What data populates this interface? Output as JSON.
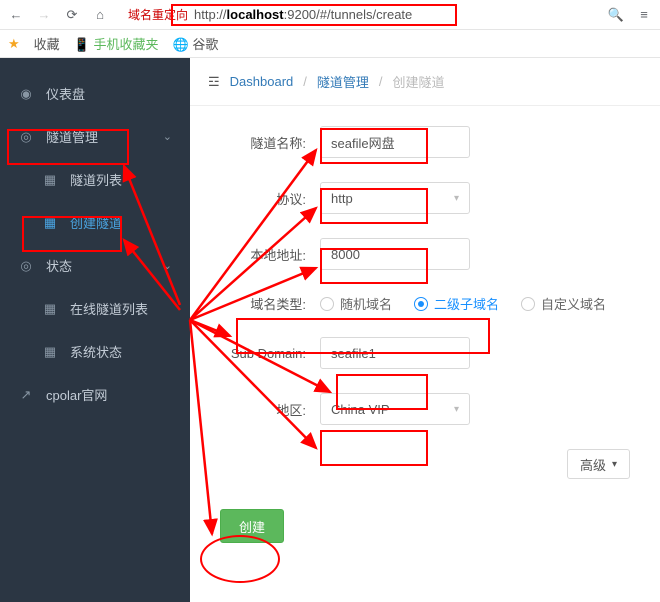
{
  "browser": {
    "redirect_label": "域名重定向",
    "url_prefix": "http://",
    "url_host": "localhost",
    "url_rest": ":9200/#/tunnels/create",
    "fav_label": "收藏",
    "mobile_label": "手机收藏夹",
    "google_label": "谷歌"
  },
  "sidebar": {
    "dashboard": "仪表盘",
    "tunnel_mgmt": "隧道管理",
    "tunnel_list": "隧道列表",
    "create_tunnel": "创建隧道",
    "status": "状态",
    "online_list": "在线隧道列表",
    "sys_status": "系统状态",
    "cpolar_site": "cpolar官网"
  },
  "crumb": {
    "dashboard": "Dashboard",
    "tunnel_mgmt": "隧道管理",
    "create_tunnel": "创建隧道"
  },
  "labels": {
    "name": "隧道名称:",
    "protocol": "协议:",
    "local_addr": "本地地址:",
    "domain_type": "域名类型:",
    "sub_domain": "Sub Domain:",
    "region": "地区:"
  },
  "values": {
    "name": "seafile网盘",
    "protocol": "http",
    "local_addr": "8000",
    "sub_domain": "seafile1",
    "region": "China VIP"
  },
  "domain_opts": {
    "random": "随机域名",
    "second": "二级子域名",
    "custom": "自定义域名"
  },
  "buttons": {
    "advanced": "高级",
    "submit": "创建"
  }
}
